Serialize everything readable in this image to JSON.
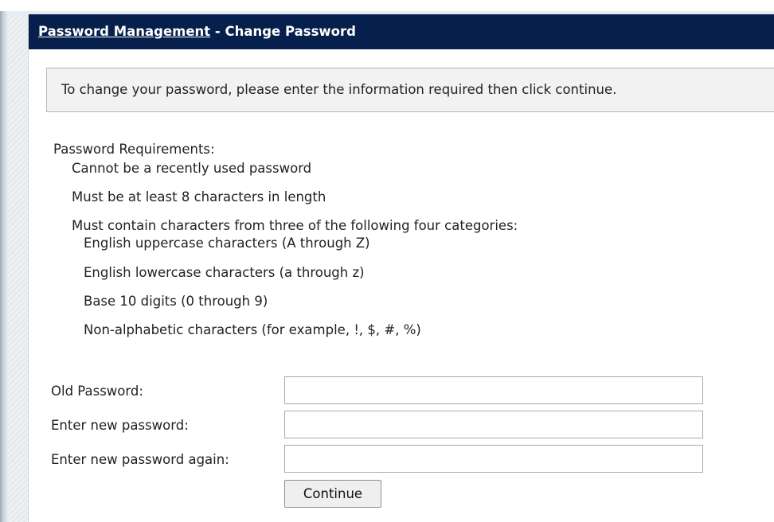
{
  "header": {
    "link": "Password Management",
    "separator": " - ",
    "title": "Change Password"
  },
  "instructions": "To change your password, please enter the information required then click continue.",
  "requirements": {
    "heading": "Password Requirements:",
    "items": [
      "Cannot be a recently used password",
      "Must be at least 8 characters in length",
      "Must contain characters from three of the following four categories:"
    ],
    "categories": [
      "English uppercase characters (A through Z)",
      "English lowercase characters (a through z)",
      "Base 10 digits (0 through 9)",
      "Non-alphabetic characters (for example, !, $, #, %)"
    ]
  },
  "form": {
    "old_password_label": "Old Password:",
    "old_password_value": "",
    "new_password_label": "Enter new password:",
    "new_password_value": "",
    "confirm_password_label": "Enter new password again:",
    "confirm_password_value": "",
    "continue_label": "Continue"
  },
  "colors": {
    "header_bg": "#061f4c",
    "instructions_bg": "#f2f2f2"
  }
}
